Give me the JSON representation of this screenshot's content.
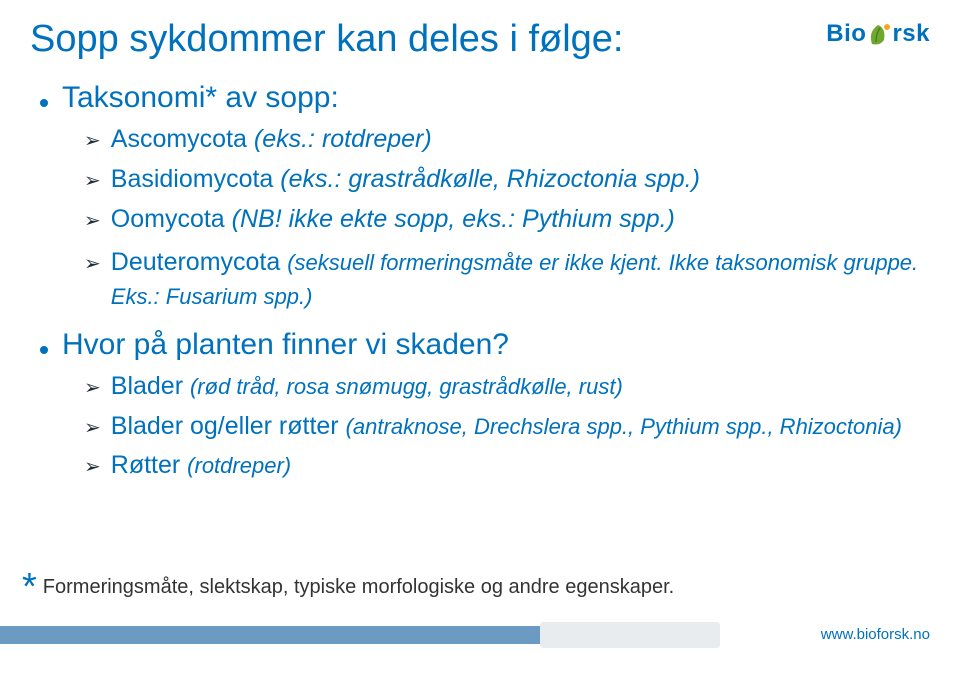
{
  "title": "Sopp sykdommer kan deles i følge:",
  "logo": {
    "part1": "Bio",
    "part2": "rsk",
    "url": "www.bioforsk.no"
  },
  "section1": {
    "heading": "Taksonomi* av sopp:",
    "items": [
      {
        "name": "Ascomycota ",
        "note": "(eks.: rotdreper)"
      },
      {
        "name": "Basidiomycota ",
        "note": "(eks.: grastrådkølle, Rhizoctonia spp.)"
      },
      {
        "name": "Oomycota ",
        "note": "(NB! ikke ekte sopp, eks.: Pythium spp.)"
      },
      {
        "name": "Deuteromycota ",
        "note": "(seksuell formeringsmåte er ikke kjent. Ikke taksonomisk gruppe. Eks.: Fusarium spp.)"
      }
    ]
  },
  "section2": {
    "heading": "Hvor på planten finner vi skaden?",
    "items": [
      {
        "name": "Blader ",
        "note": "(rød tråd, rosa snømugg, grastrådkølle, rust)"
      },
      {
        "name": "Blader og/eller røtter ",
        "note": "(antraknose, Drechslera spp., Pythium spp., Rhizoctonia)"
      },
      {
        "name": "Røtter ",
        "note": "(rotdreper)"
      }
    ]
  },
  "footnote": {
    "mark": "*",
    "text": "Formeringsmåte, slektskap, typiske morfologiske og andre egenskaper."
  }
}
